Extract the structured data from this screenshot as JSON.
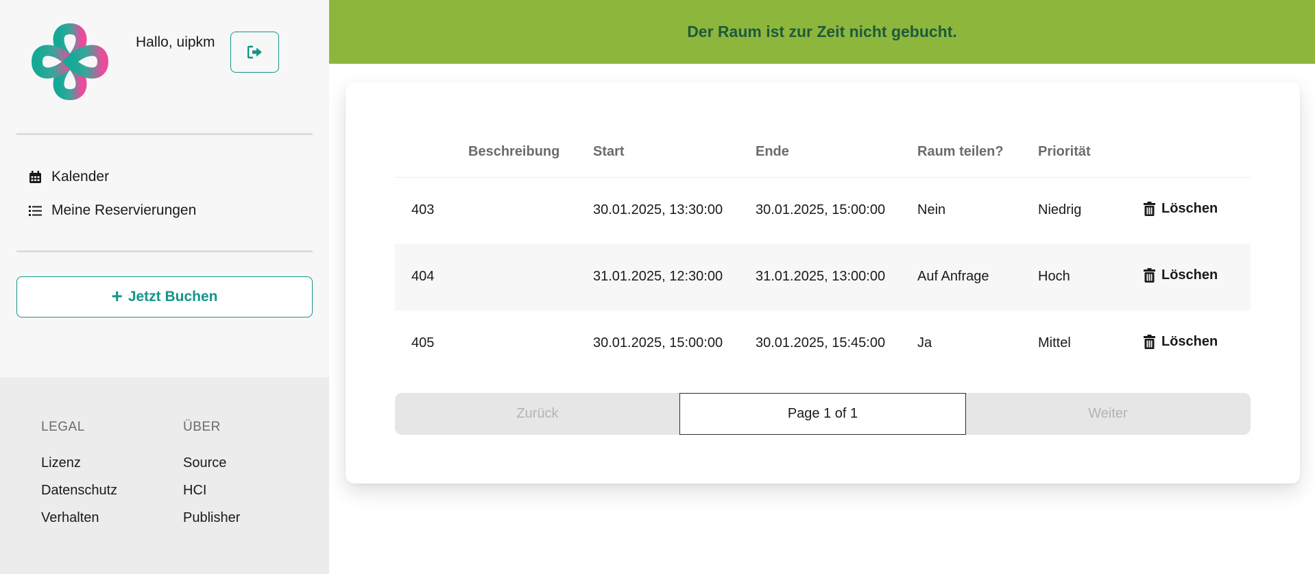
{
  "user": {
    "greeting": "Hallo, uipkm"
  },
  "sidebar": {
    "nav": [
      {
        "label": "Kalender",
        "icon": "calendar-icon"
      },
      {
        "label": "Meine Reservierungen",
        "icon": "list-icon"
      }
    ],
    "book_button": {
      "label": "Jetzt Buchen",
      "icon": "plus-icon"
    }
  },
  "footer": {
    "legal": {
      "heading": "LEGAL",
      "links": [
        "Lizenz",
        "Datenschutz",
        "Verhalten"
      ]
    },
    "about": {
      "heading": "ÜBER",
      "links": [
        "Source",
        "HCI",
        "Publisher"
      ]
    }
  },
  "banner": {
    "text": "Der Raum ist zur Zeit nicht gebucht.",
    "color": "#8db63d"
  },
  "table": {
    "headers": [
      "Beschreibung",
      "Start",
      "Ende",
      "Raum teilen?",
      "Priorität"
    ],
    "rows": [
      {
        "id": "403",
        "beschreibung": "",
        "start": "30.01.2025, 13:30:00",
        "ende": "30.01.2025, 15:00:00",
        "teilen": "Nein",
        "prioritaet": "Niedrig",
        "action": "Löschen"
      },
      {
        "id": "404",
        "beschreibung": "",
        "start": "31.01.2025, 12:30:00",
        "ende": "31.01.2025, 13:00:00",
        "teilen": "Auf Anfrage",
        "prioritaet": "Hoch",
        "action": "Löschen"
      },
      {
        "id": "405",
        "beschreibung": "",
        "start": "30.01.2025, 15:00:00",
        "ende": "30.01.2025, 15:45:00",
        "teilen": "Ja",
        "prioritaet": "Mittel",
        "action": "Löschen"
      }
    ]
  },
  "pagination": {
    "prev": "Zurück",
    "info": "Page 1 of 1",
    "next": "Weiter"
  },
  "colors": {
    "accent": "#13948a",
    "banner": "#8db63d",
    "banner_text": "#1e5a3c"
  }
}
